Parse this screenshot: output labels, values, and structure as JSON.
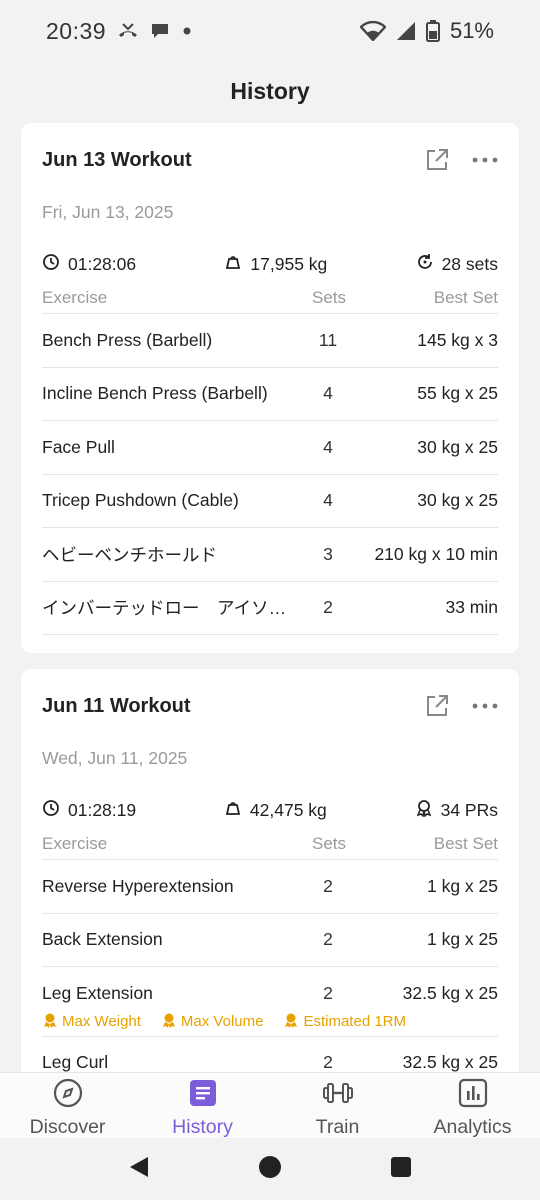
{
  "status": {
    "time": "20:39",
    "battery_pct": "51%"
  },
  "header": {
    "title": "History"
  },
  "table_headers": {
    "exercise": "Exercise",
    "sets": "Sets",
    "best": "Best Set"
  },
  "workouts": [
    {
      "title": "Jun 13 Workout",
      "date": "Fri, Jun 13, 2025",
      "duration": "01:28:06",
      "volume": "17,955 kg",
      "extra": "28 sets",
      "extra_icon": "replay-icon",
      "rows": [
        {
          "exercise": "Bench Press (Barbell)",
          "sets": "11",
          "best": "145 kg x 3"
        },
        {
          "exercise": "Incline Bench Press (Barbell)",
          "sets": "4",
          "best": "55 kg x 25"
        },
        {
          "exercise": "Face Pull",
          "sets": "4",
          "best": "30 kg x 25"
        },
        {
          "exercise": "Tricep Pushdown (Cable)",
          "sets": "4",
          "best": "30 kg x 25"
        },
        {
          "exercise": "ヘビーベンチホールド",
          "sets": "3",
          "best": "210 kg x 10 min"
        },
        {
          "exercise": "インバーテッドロー　アイソメ…",
          "sets": "2",
          "best": "33 min"
        }
      ]
    },
    {
      "title": "Jun 11 Workout",
      "date": "Wed, Jun 11, 2025",
      "duration": "01:28:19",
      "volume": "42,475 kg",
      "extra": "34 PRs",
      "extra_icon": "medal-icon",
      "rows": [
        {
          "exercise": "Reverse Hyperextension",
          "sets": "2",
          "best": "1 kg x 25"
        },
        {
          "exercise": "Back Extension",
          "sets": "2",
          "best": "1 kg x 25"
        },
        {
          "exercise": "Leg Extension",
          "sets": "2",
          "best": "32.5 kg x 25",
          "prs": [
            "Max Weight",
            "Max Volume",
            "Estimated 1RM"
          ]
        },
        {
          "exercise": "Leg Curl",
          "sets": "2",
          "best": "32.5 kg x 25"
        }
      ]
    }
  ],
  "nav": [
    {
      "label": "Discover",
      "icon": "compass-icon"
    },
    {
      "label": "History",
      "icon": "history-icon",
      "active": true
    },
    {
      "label": "Train",
      "icon": "dumbbell-icon"
    },
    {
      "label": "Analytics",
      "icon": "bar-chart-icon"
    }
  ],
  "colors": {
    "accent": "#7c5cdb",
    "pr": "#e8a200",
    "muted": "#9a9a9a"
  }
}
